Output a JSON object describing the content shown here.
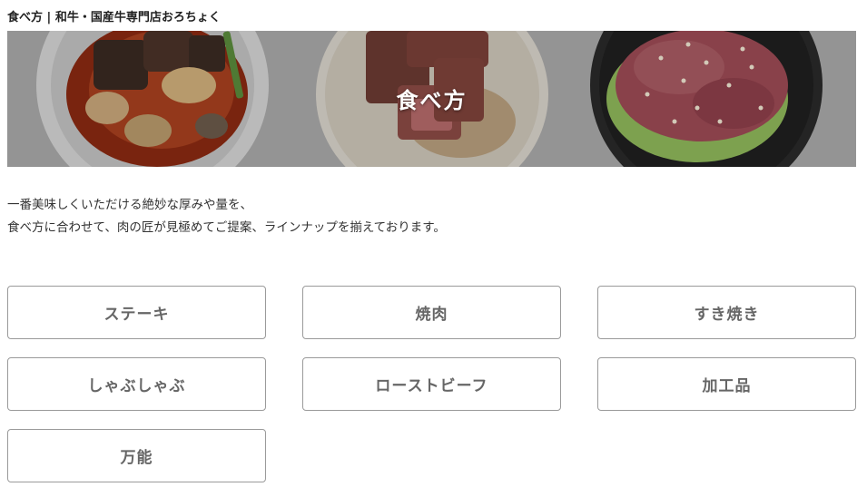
{
  "breadcrumb": {
    "current": "食べ方",
    "separator": "|",
    "site": "和牛・国産牛専門店おろちょく"
  },
  "hero": {
    "title": "食べ方",
    "images": [
      "braised-beef-dish-photo",
      "sliced-steak-photo",
      "seared-beef-salad-photo"
    ]
  },
  "intro": {
    "line1": "一番美味しくいただける絶妙な厚みや量を、",
    "line2": "食べ方に合わせて、肉の匠が見極めてご提案、ラインナップを揃えております。"
  },
  "categories": [
    {
      "label": "ステーキ"
    },
    {
      "label": "焼肉"
    },
    {
      "label": "すき焼き"
    },
    {
      "label": "しゃぶしゃぶ"
    },
    {
      "label": "ローストビーフ"
    },
    {
      "label": "加工品"
    },
    {
      "label": "万能"
    }
  ],
  "colors": {
    "button_border": "#9a9a9a",
    "button_text": "#666666",
    "hero_overlay": "#a9a9a9"
  }
}
